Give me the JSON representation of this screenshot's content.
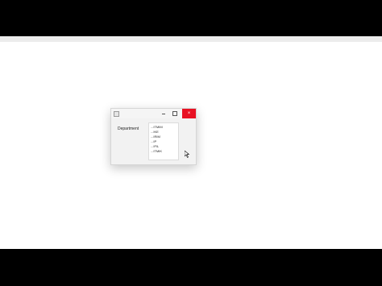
{
  "window": {
    "title": "",
    "close_symbol": "×"
  },
  "form": {
    "department_label": "Department"
  },
  "departments": [
    "...ITMIM",
    "...IKE",
    "...IRIM",
    "...IP",
    "...IFIL",
    "...ITMIK"
  ],
  "icons": {
    "app": "app-window-icon",
    "minimize": "minimize-icon",
    "maximize": "maximize-icon",
    "close": "close-icon"
  },
  "colors": {
    "close_button": "#e81123",
    "window_bg": "#f2f2f2",
    "desktop_bg": "#ffffff",
    "letterbox": "#000000"
  }
}
